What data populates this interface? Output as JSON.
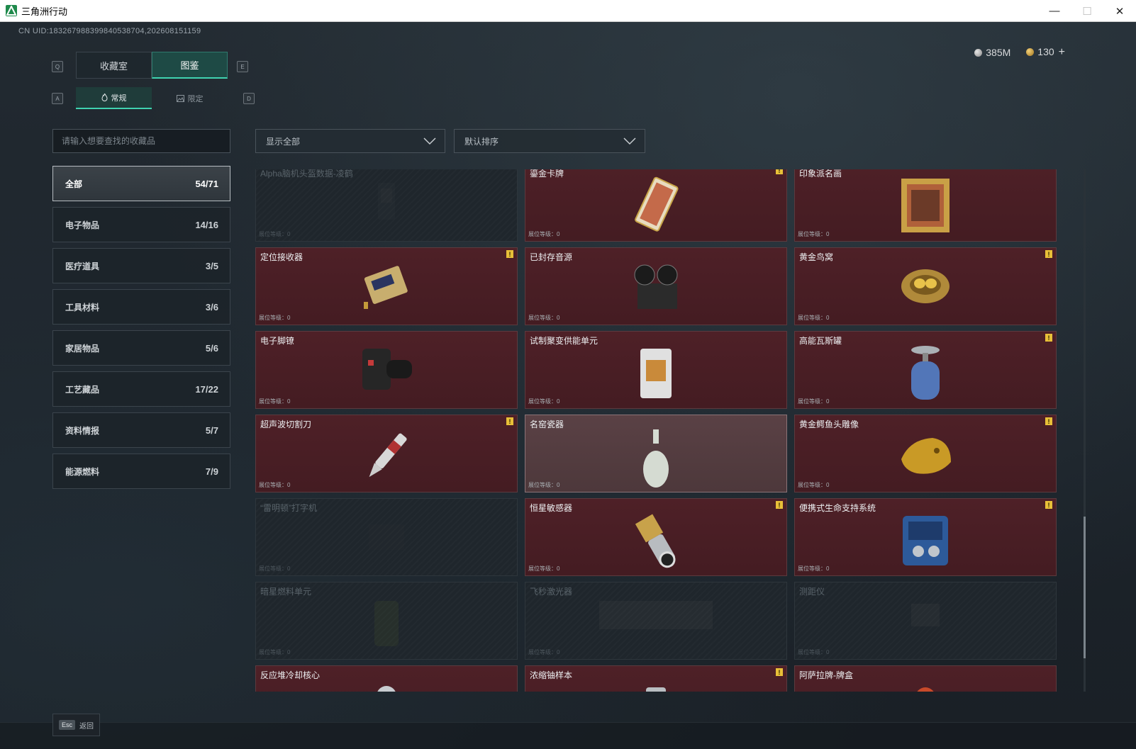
{
  "window": {
    "title": "三角洲行动",
    "min": "—",
    "max": "☐",
    "close": "✕"
  },
  "uid": "CN UID:1832679883998405387​04,202608151159",
  "currency": {
    "silver": "385M",
    "gold": "130",
    "plus": "+"
  },
  "keys": {
    "q": "Q",
    "e": "E",
    "a": "A",
    "d": "D"
  },
  "main_tabs": [
    {
      "label": "收藏室"
    },
    {
      "label": "图鉴"
    }
  ],
  "sub_tabs": [
    {
      "label": "常规"
    },
    {
      "label": "限定"
    }
  ],
  "search": {
    "placeholder": "请输入想要查找的收藏品"
  },
  "filters": {
    "show": "显示全部",
    "sort": "默认排序"
  },
  "categories": [
    {
      "label": "全部",
      "count": "54/71"
    },
    {
      "label": "电子物品",
      "count": "14/16"
    },
    {
      "label": "医疗道具",
      "count": "3/5"
    },
    {
      "label": "工具材料",
      "count": "3/6"
    },
    {
      "label": "家居物品",
      "count": "5/6"
    },
    {
      "label": "工艺藏品",
      "count": "17/22"
    },
    {
      "label": "资料情报",
      "count": "5/7"
    },
    {
      "label": "能源燃料",
      "count": "7/9"
    }
  ],
  "level_label": "展位等级：0",
  "items": [
    {
      "name": "Alpha脑机头盔数据-凌鹤",
      "state": "locked"
    },
    {
      "name": "鎏金卡牌",
      "state": "owned",
      "badge": "!"
    },
    {
      "name": "印象派名画",
      "state": "owned"
    },
    {
      "name": "定位接收器",
      "state": "owned",
      "badge": "!"
    },
    {
      "name": "已封存音源",
      "state": "owned"
    },
    {
      "name": "黄金鸟窝",
      "state": "owned",
      "badge": "!"
    },
    {
      "name": "电子脚镣",
      "state": "owned"
    },
    {
      "name": "试制聚变供能单元",
      "state": "owned"
    },
    {
      "name": "高能瓦斯罐",
      "state": "owned",
      "badge": "!"
    },
    {
      "name": "超声波切割刀",
      "state": "owned",
      "badge": "!"
    },
    {
      "name": "名窑瓷器",
      "state": "highlight"
    },
    {
      "name": "黄金鳄鱼头雕像",
      "state": "owned",
      "badge": "!"
    },
    {
      "name": "“雷明顿”打字机",
      "state": "locked"
    },
    {
      "name": "恒星敏感器",
      "state": "owned",
      "badge": "!"
    },
    {
      "name": "便携式生命支持系统",
      "state": "owned",
      "badge": "!"
    },
    {
      "name": "暗星燃料单元",
      "state": "locked"
    },
    {
      "name": "飞秒激光器",
      "state": "locked"
    },
    {
      "name": "测距仪",
      "state": "locked"
    },
    {
      "name": "反应堆冷却核心",
      "state": "owned"
    },
    {
      "name": "浓缩铀样本",
      "state": "owned",
      "badge": "!"
    },
    {
      "name": "阿萨拉牌-牌盒",
      "state": "owned"
    }
  ],
  "footer": {
    "esc": "Esc",
    "back": "返回"
  }
}
